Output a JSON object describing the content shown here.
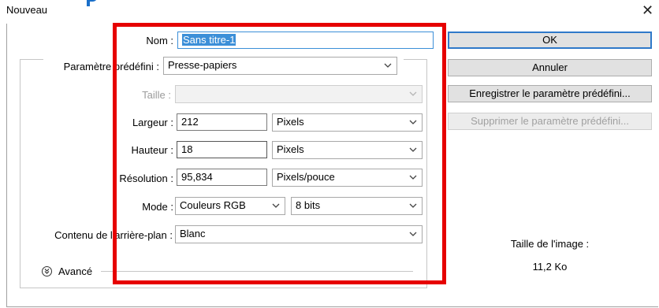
{
  "window": {
    "title": "Nouveau",
    "close_glyph": "✕"
  },
  "form": {
    "nom": {
      "label": "Nom :",
      "value": "Sans titre-1"
    },
    "preset": {
      "label": "Paramètre prédéfini :",
      "value": "Presse-papiers"
    },
    "taille": {
      "label": "Taille :",
      "value": ""
    },
    "largeur": {
      "label": "Largeur :",
      "value": "212",
      "unit": "Pixels"
    },
    "hauteur": {
      "label": "Hauteur :",
      "value": "18",
      "unit": "Pixels"
    },
    "resolution": {
      "label": "Résolution :",
      "value": "95,834",
      "unit": "Pixels/pouce"
    },
    "mode": {
      "label": "Mode :",
      "value": "Couleurs RGB",
      "depth": "8 bits"
    },
    "background": {
      "label": "Contenu de l'arrière-plan :",
      "value": "Blanc"
    },
    "advanced": {
      "label": "Avancé",
      "icon": "»"
    }
  },
  "buttons": {
    "ok": "OK",
    "cancel": "Annuler",
    "save_preset": "Enregistrer le paramètre prédéfini...",
    "delete_preset": "Supprimer le paramètre prédéfini..."
  },
  "image_size": {
    "label": "Taille de l'image :",
    "value": "11,2 Ko"
  },
  "colors": {
    "highlight_border": "#e60000",
    "selection": "#3c8fd8",
    "default_button_border": "#2f79c9"
  }
}
